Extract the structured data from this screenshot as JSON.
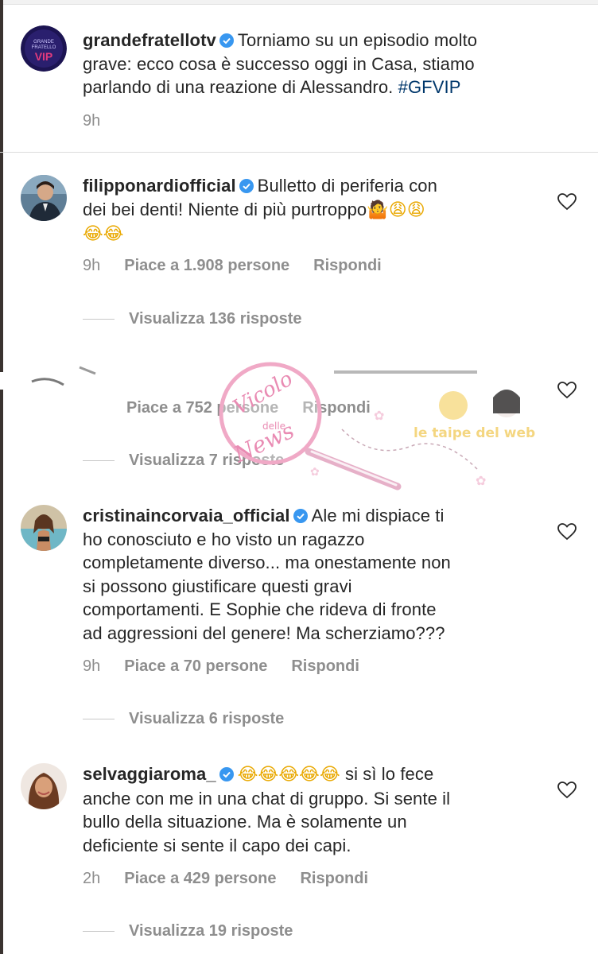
{
  "caption": {
    "username": "grandefratellotv",
    "text": "Torniamo su un episodio molto",
    "text_line2": "grave: ecco cosa è successo oggi in Casa, stiamo",
    "text_line3": "parlando di una reazione di Alessandro.",
    "hashtag": "#GFVIP",
    "time": "9h",
    "avatar_label": "VIP"
  },
  "comments": [
    {
      "username": "filipponardiofficial",
      "line1": "Bulletto di periferia con",
      "line2": "dei bei denti! Niente di più purtroppo",
      "line2_emoji": "🤷😩😩",
      "line3_emoji": "😂😂",
      "time": "9h",
      "likes": "Piace a 1.908 persone",
      "reply": "Rispondi",
      "view_replies": "Visualizza 136 risposte"
    },
    {
      "username": "",
      "line1": "",
      "time": "",
      "likes": "Piace a 752 persone",
      "reply": "Rispondi",
      "view_replies": "Visualizza 7 risposte"
    },
    {
      "username": "cristinaincorvaia_official",
      "line1": "Ale mi dispiace ti",
      "line2": "ho conosciuto e ho visto un ragazzo",
      "line3": "completamente diverso... ma onestamente non",
      "line4": "si possono giustificare questi gravi",
      "line5": "comportamenti.  E Sophie che rideva di fronte",
      "line6": "ad aggressioni del genere! Ma scherziamo???",
      "time": "9h",
      "likes": "Piace a 70 persone",
      "reply": "Rispondi",
      "view_replies": "Visualizza 6 risposte"
    },
    {
      "username": "selvaggiaroma_",
      "emoji": "😂😂😂😂😂",
      "line1": "si sì lo fece",
      "line2": "anche con me in una chat di gruppo. Si sente il",
      "line3": "bullo della situazione. Ma è solamente un",
      "line4": "deficiente si sente il capo dei capi.",
      "time": "2h",
      "likes": "Piace a 429 persone",
      "reply": "Rispondi",
      "view_replies": "Visualizza 19 risposte"
    }
  ],
  "watermark": {
    "text1": "Vicolo",
    "text2": "delle",
    "text3": "News",
    "text4": "le taipe del web"
  },
  "colors": {
    "text": "#262626",
    "muted": "#8e8e8e",
    "hashtag": "#00376b",
    "verified": "#3897f0",
    "divider": "#dbdbdb"
  },
  "icons": [
    "verified-badge-icon",
    "heart-icon",
    "magnifier-watermark-icon"
  ]
}
